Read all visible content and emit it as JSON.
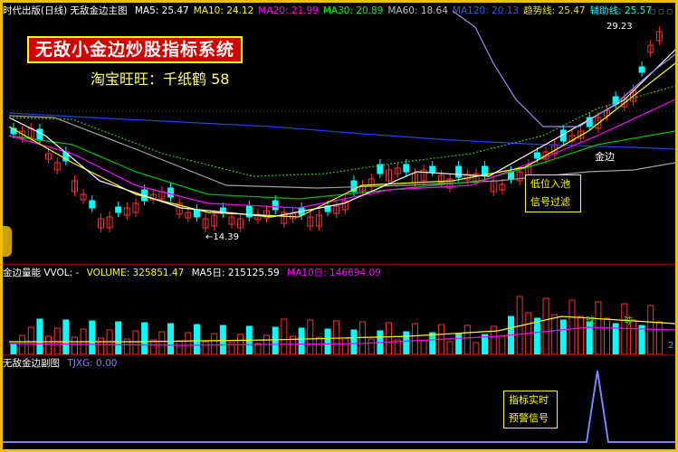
{
  "header": {
    "title": "时代出版(日线) 无敌金边主图",
    "ma": [
      {
        "label": "MA5: 25.47",
        "color": "#ffffff"
      },
      {
        "label": "MA10: 24.12",
        "color": "#ffff00"
      },
      {
        "label": "MA20: 21.99",
        "color": "#ff00ff"
      },
      {
        "label": "MA30: 20.89",
        "color": "#00ff00"
      },
      {
        "label": "MA60: 18.64",
        "color": "#c0c0c0"
      },
      {
        "label": "MA120: 20.13",
        "color": "#2060ff"
      },
      {
        "label": "趋势线: 25.47",
        "color": "#e0e020"
      },
      {
        "label": "辅助线: 25.57",
        "color": "#00ffff"
      }
    ]
  },
  "promo": {
    "title": "无敌小金边炒股指标系统",
    "shop": "淘宝旺旺：千纸鹤 58"
  },
  "main_chart": {
    "high_label": "29.23",
    "low_label": "←14.39",
    "gold_edge_label": "金边",
    "annotation_lines": [
      "低位入池",
      "信号过滤"
    ]
  },
  "volume_panel": {
    "title": "金边量能 VVOL: -",
    "volume": "VOLUME: 325851.47",
    "ma5": "MA5日: 215125.59",
    "ma10": "MA10日: 146694.09",
    "marker": "球",
    "right_tick": "2"
  },
  "sub_panel": {
    "title": "无敌金边副图",
    "value": "TJXG: 0.00",
    "annotation_lines": [
      "指标实时",
      "预警信号"
    ]
  },
  "colors": {
    "up": "#ff3030",
    "down": "#00ffff",
    "border": "#f0c000",
    "panel_sep": "#8b0000"
  },
  "icons": [
    "side-tab-arrow-icon",
    "window-control-icons"
  ]
}
